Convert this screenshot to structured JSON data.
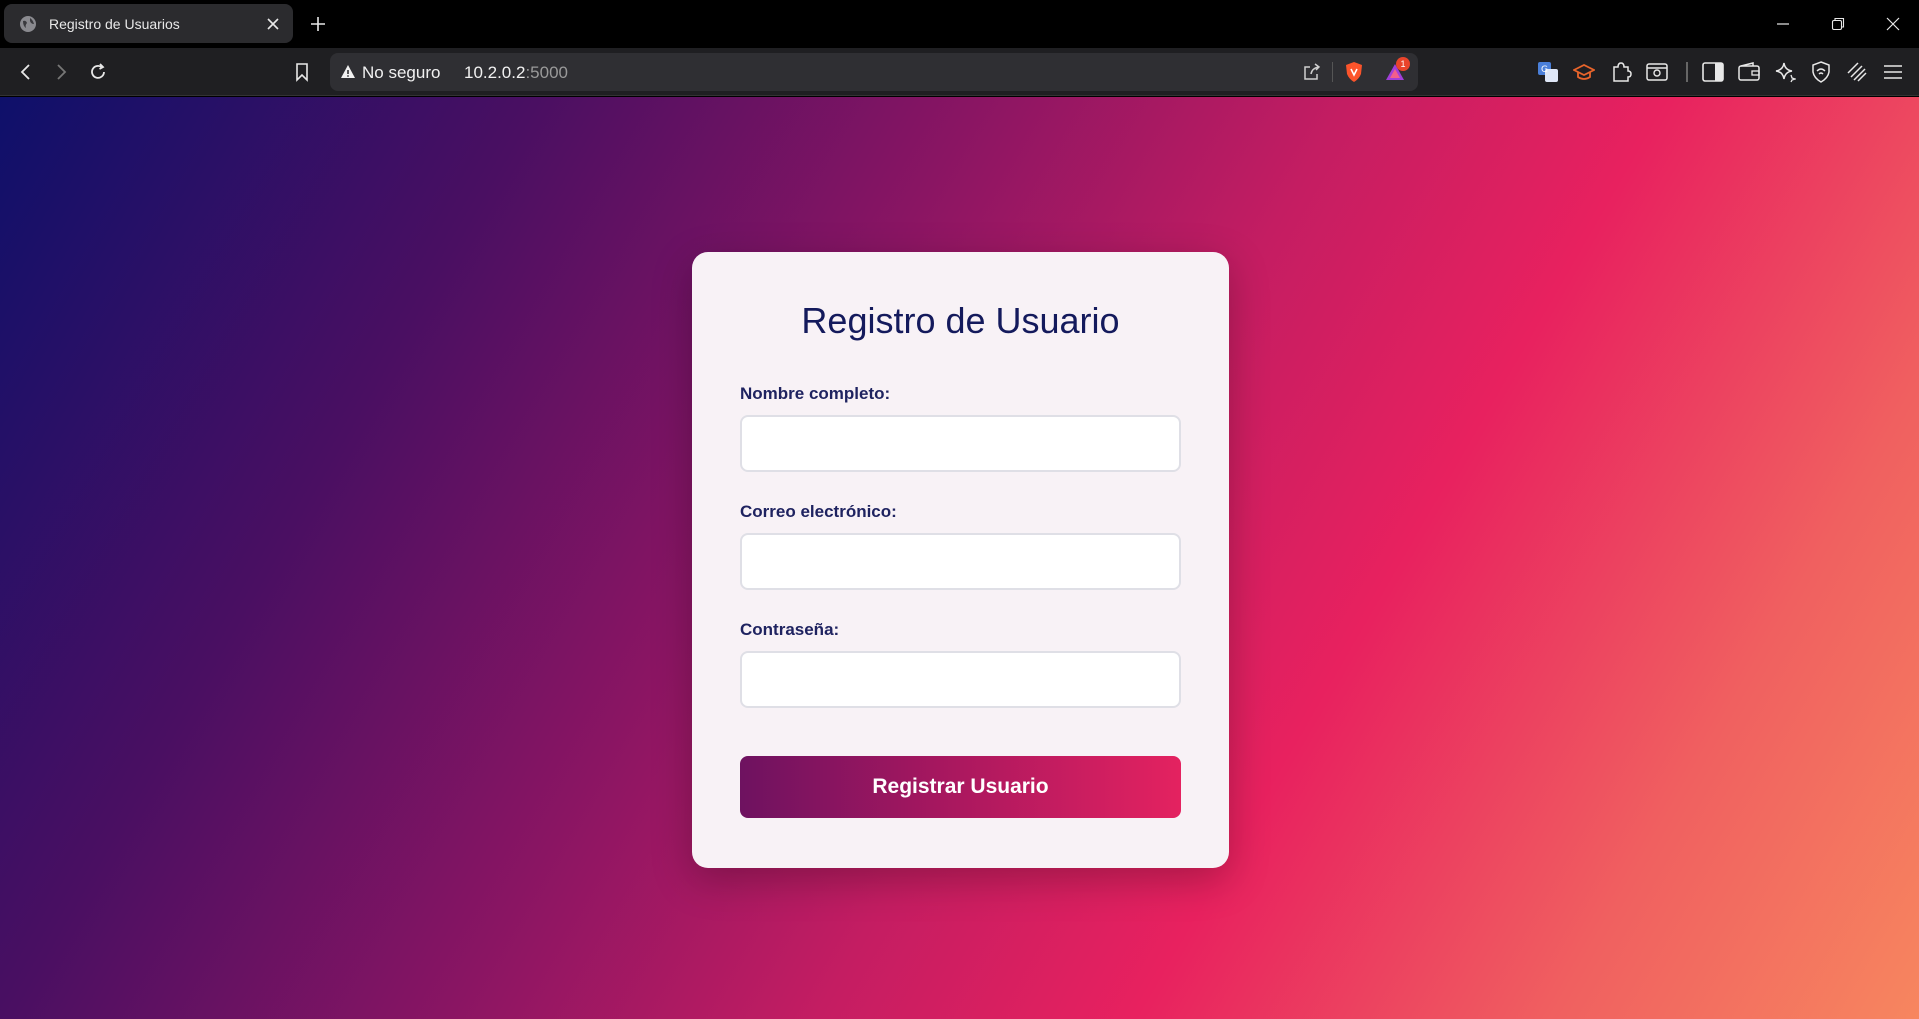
{
  "browser": {
    "tab": {
      "title": "Registro de Usuarios",
      "favicon": "globe-icon",
      "close_icon": "close-icon"
    },
    "new_tab_icon": "plus-icon",
    "window_controls": [
      "minimize-icon",
      "restore-icon",
      "close-icon"
    ],
    "toolbar": {
      "back_icon": "back-arrow-icon",
      "forward_icon": "forward-arrow-icon",
      "reload_icon": "reload-icon",
      "bookmark_icon": "bookmark-icon"
    },
    "address_bar": {
      "security_label": "No seguro",
      "host": "10.2.0.2",
      "port": ":5000",
      "share_icon": "share-icon",
      "shield_icon": "brave-shield-icon",
      "rewards_icon": "brave-rewards-icon",
      "rewards_badge": "1"
    },
    "extensions": [
      "translate-icon",
      "graduation-cap-icon",
      "puzzle-icon",
      "reader-icon",
      "sidebar-icon",
      "wallet-icon",
      "leo-ai-icon",
      "vpn-icon",
      "rewards-stack-icon",
      "menu-icon"
    ]
  },
  "colors": {
    "gradient_start": "#0e106a",
    "gradient_mid": "#e8215f",
    "gradient_end": "#f7865f",
    "card_bg": "#f8f2f6",
    "title_color": "#141a5c",
    "button_start": "#6e1260",
    "button_end": "#e42260"
  },
  "form": {
    "title": "Registro de Usuario",
    "fields": [
      {
        "label": "Nombre completo:",
        "value": "",
        "placeholder": ""
      },
      {
        "label": "Correo electrónico:",
        "value": "",
        "placeholder": ""
      },
      {
        "label": "Contraseña:",
        "value": "",
        "placeholder": ""
      }
    ],
    "submit_label": "Registrar Usuario"
  }
}
